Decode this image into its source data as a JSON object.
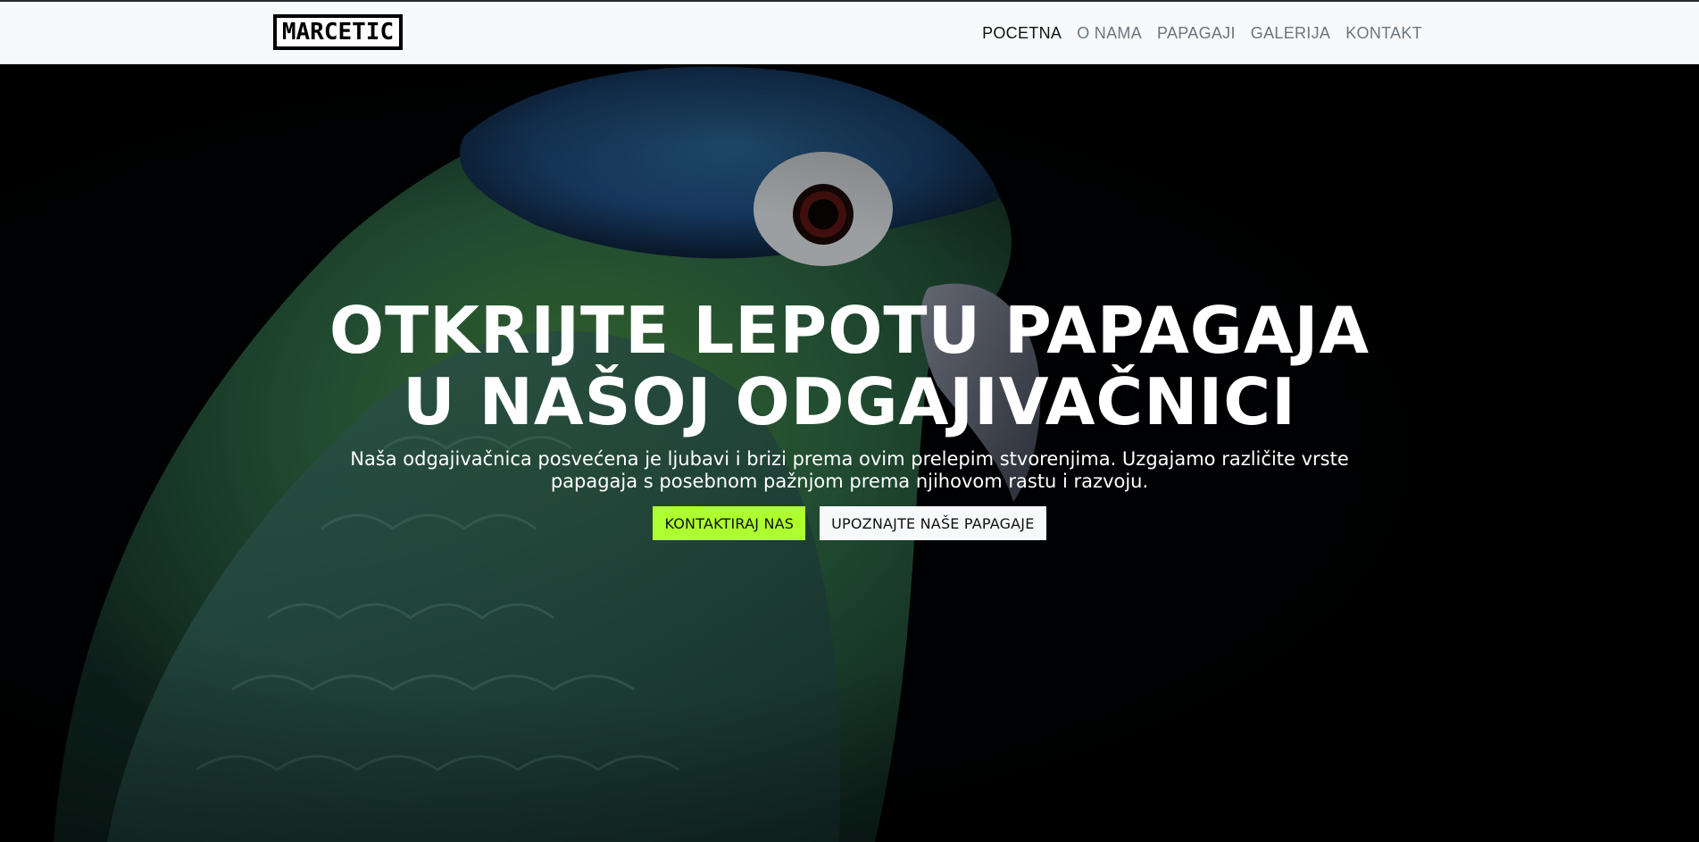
{
  "brand": {
    "logo_text": "MARCETIC"
  },
  "nav": {
    "items": [
      {
        "label": "POCETNA",
        "active": true
      },
      {
        "label": "O NAMA",
        "active": false
      },
      {
        "label": "PAPAGAJI",
        "active": false
      },
      {
        "label": "GALERIJA",
        "active": false
      },
      {
        "label": "KONTAKT",
        "active": false
      }
    ]
  },
  "hero": {
    "title": "OTKRIJTE LEPOTU PAPAGAJA U NAŠOJ ODGAJIVAČNICI",
    "subtitle": "Naša odgajivačnica posvećena je ljubavi i brizi prema ovim prelepim stvorenjima. Uzgajamo različite vrste papagaja s posebnom pažnjom prema njihovom rastu i razvoju.",
    "primary_button": "KONTAKTIRAJ NAS",
    "secondary_button": "UPOZNAJTE NAŠE PAPAGAJE",
    "background_icon": "parrot-image"
  },
  "colors": {
    "accent": "#adff2f",
    "navbar_bg": "#f8f9fa",
    "hero_bg": "#010203"
  }
}
